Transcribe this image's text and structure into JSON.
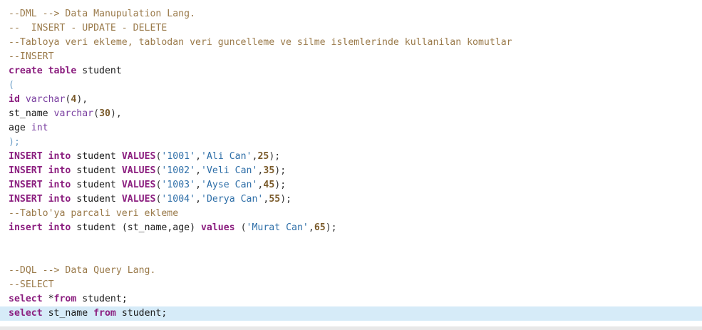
{
  "editor": {
    "lines": [
      [
        {
          "t": "--DML --> Data Manupulation Lang.",
          "c": "comment"
        }
      ],
      [
        {
          "t": "--  INSERT - UPDATE - DELETE",
          "c": "comment"
        }
      ],
      [
        {
          "t": "--Tabloya veri ekleme, tablodan veri guncelleme ve silme islemlerinde kullanilan komutlar",
          "c": "comment"
        }
      ],
      [
        {
          "t": "--INSERT",
          "c": "comment"
        }
      ],
      [
        {
          "t": "create",
          "c": "kw"
        },
        {
          "t": " ",
          "c": "ident"
        },
        {
          "t": "table",
          "c": "kw"
        },
        {
          "t": " student",
          "c": "ident"
        }
      ],
      [
        {
          "t": "(",
          "c": "paren"
        }
      ],
      [
        {
          "t": "id",
          "c": "kw"
        },
        {
          "t": " ",
          "c": "ident"
        },
        {
          "t": "varchar",
          "c": "type"
        },
        {
          "t": "(",
          "c": "punct"
        },
        {
          "t": "4",
          "c": "num"
        },
        {
          "t": "),",
          "c": "punct"
        }
      ],
      [
        {
          "t": "st_name ",
          "c": "ident"
        },
        {
          "t": "varchar",
          "c": "type"
        },
        {
          "t": "(",
          "c": "punct"
        },
        {
          "t": "30",
          "c": "num"
        },
        {
          "t": "),",
          "c": "punct"
        }
      ],
      [
        {
          "t": "age ",
          "c": "ident"
        },
        {
          "t": "int",
          "c": "type"
        }
      ],
      [
        {
          "t": ");",
          "c": "paren"
        }
      ],
      [
        {
          "t": "INSERT",
          "c": "kw"
        },
        {
          "t": " ",
          "c": "ident"
        },
        {
          "t": "into",
          "c": "kw"
        },
        {
          "t": " student ",
          "c": "ident"
        },
        {
          "t": "VALUES",
          "c": "kw"
        },
        {
          "t": "(",
          "c": "punct"
        },
        {
          "t": "'1001'",
          "c": "str"
        },
        {
          "t": ",",
          "c": "punct"
        },
        {
          "t": "'Ali Can'",
          "c": "str"
        },
        {
          "t": ",",
          "c": "punct"
        },
        {
          "t": "25",
          "c": "num"
        },
        {
          "t": ");",
          "c": "punct"
        }
      ],
      [
        {
          "t": "INSERT",
          "c": "kw"
        },
        {
          "t": " ",
          "c": "ident"
        },
        {
          "t": "into",
          "c": "kw"
        },
        {
          "t": " student ",
          "c": "ident"
        },
        {
          "t": "VALUES",
          "c": "kw"
        },
        {
          "t": "(",
          "c": "punct"
        },
        {
          "t": "'1002'",
          "c": "str"
        },
        {
          "t": ",",
          "c": "punct"
        },
        {
          "t": "'Veli Can'",
          "c": "str"
        },
        {
          "t": ",",
          "c": "punct"
        },
        {
          "t": "35",
          "c": "num"
        },
        {
          "t": ");",
          "c": "punct"
        }
      ],
      [
        {
          "t": "INSERT",
          "c": "kw"
        },
        {
          "t": " ",
          "c": "ident"
        },
        {
          "t": "into",
          "c": "kw"
        },
        {
          "t": " student ",
          "c": "ident"
        },
        {
          "t": "VALUES",
          "c": "kw"
        },
        {
          "t": "(",
          "c": "punct"
        },
        {
          "t": "'1003'",
          "c": "str"
        },
        {
          "t": ",",
          "c": "punct"
        },
        {
          "t": "'Ayse Can'",
          "c": "str"
        },
        {
          "t": ",",
          "c": "punct"
        },
        {
          "t": "45",
          "c": "num"
        },
        {
          "t": ");",
          "c": "punct"
        }
      ],
      [
        {
          "t": "INSERT",
          "c": "kw"
        },
        {
          "t": " ",
          "c": "ident"
        },
        {
          "t": "into",
          "c": "kw"
        },
        {
          "t": " student ",
          "c": "ident"
        },
        {
          "t": "VALUES",
          "c": "kw"
        },
        {
          "t": "(",
          "c": "punct"
        },
        {
          "t": "'1004'",
          "c": "str"
        },
        {
          "t": ",",
          "c": "punct"
        },
        {
          "t": "'Derya Can'",
          "c": "str"
        },
        {
          "t": ",",
          "c": "punct"
        },
        {
          "t": "55",
          "c": "num"
        },
        {
          "t": ");",
          "c": "punct"
        }
      ],
      [
        {
          "t": "--Tablo'ya parcali veri ekleme",
          "c": "comment"
        }
      ],
      [
        {
          "t": "insert",
          "c": "kw"
        },
        {
          "t": " ",
          "c": "ident"
        },
        {
          "t": "into",
          "c": "kw"
        },
        {
          "t": " student (st_name,age) ",
          "c": "ident"
        },
        {
          "t": "values",
          "c": "kw"
        },
        {
          "t": " (",
          "c": "punct"
        },
        {
          "t": "'Murat Can'",
          "c": "str"
        },
        {
          "t": ",",
          "c": "punct"
        },
        {
          "t": "65",
          "c": "num"
        },
        {
          "t": ");",
          "c": "punct"
        }
      ],
      [],
      [],
      [
        {
          "t": "--DQL --> Data Query Lang.",
          "c": "comment"
        }
      ],
      [
        {
          "t": "--SELECT",
          "c": "comment"
        }
      ],
      [
        {
          "t": "select",
          "c": "kw"
        },
        {
          "t": " *",
          "c": "ident"
        },
        {
          "t": "from",
          "c": "kw"
        },
        {
          "t": " student;",
          "c": "ident"
        }
      ],
      [
        {
          "t": "select",
          "c": "kw"
        },
        {
          "t": " st_name ",
          "c": "ident"
        },
        {
          "t": "from",
          "c": "kw"
        },
        {
          "t": " student;",
          "c": "ident"
        }
      ]
    ],
    "current_line": 21
  }
}
